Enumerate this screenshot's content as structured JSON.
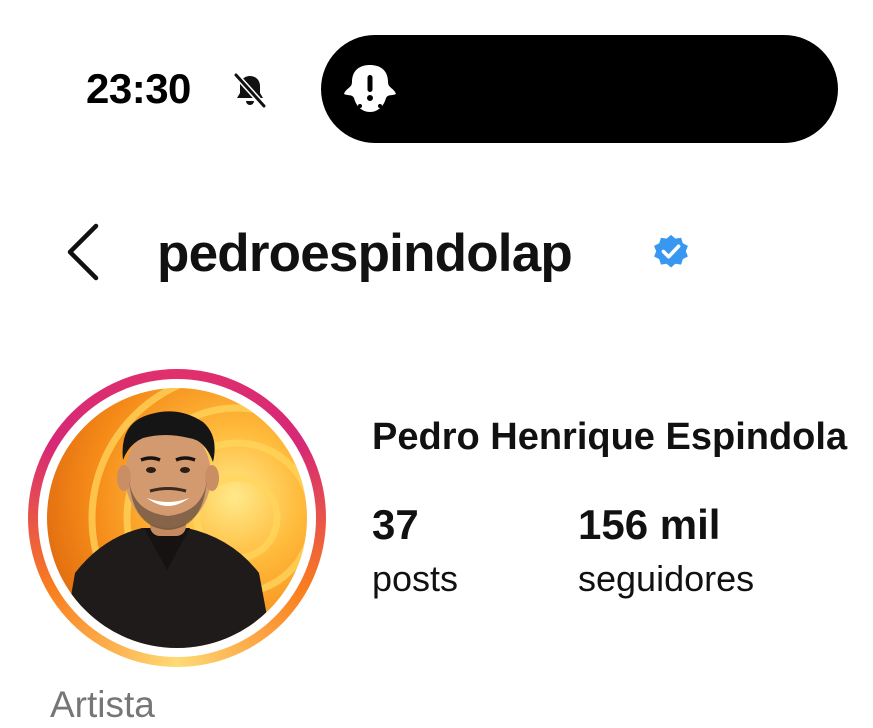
{
  "status_bar": {
    "time": "23:30",
    "bell_icon": "bell-slash-icon",
    "island_icon": "ghost-alert-icon"
  },
  "header": {
    "back_icon": "chevron-left-icon",
    "username": "pedroespindolap",
    "verified_icon": "verified-badge-icon",
    "verified_color": "#3897f0"
  },
  "profile": {
    "full_name": "Pedro Henrique Espindola",
    "stats": [
      {
        "value": "37",
        "label": "posts"
      },
      {
        "value": "156 mil",
        "label": "seguidores"
      }
    ],
    "category": "Artista",
    "story_ring_colors": [
      "#feda75",
      "#fa7e1e",
      "#d62976"
    ]
  }
}
